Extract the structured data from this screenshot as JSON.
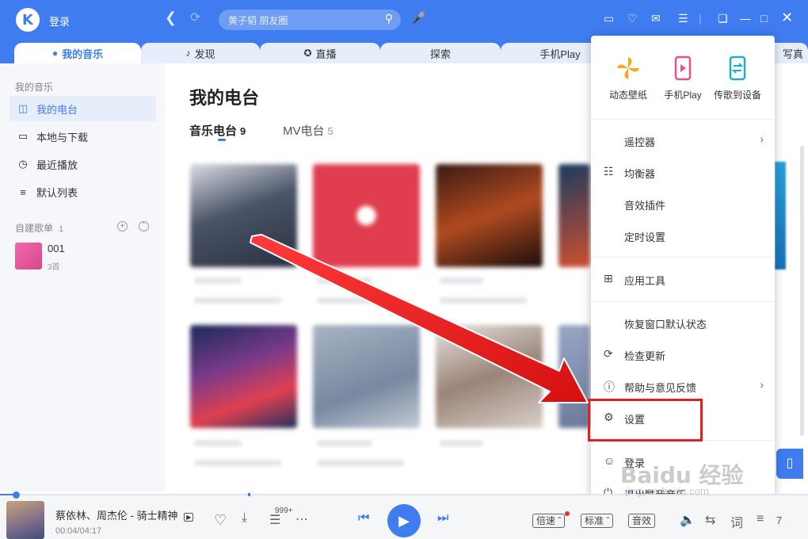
{
  "header": {
    "logo_letter": "K",
    "login": "登录",
    "search_placeholder": "黄子韬 朋友圈"
  },
  "tabs": [
    {
      "label": "我的音乐",
      "icon": "person-icon"
    },
    {
      "label": "发现",
      "icon": "music-note-icon"
    },
    {
      "label": "直播",
      "icon": "star-icon"
    },
    {
      "label": "探索",
      "icon": ""
    },
    {
      "label": "手机Play",
      "icon": ""
    },
    {
      "label": "写真",
      "icon": ""
    }
  ],
  "sidebar": {
    "section_title": "我的音乐",
    "items": [
      {
        "label": "我的电台",
        "icon": "radio-icon"
      },
      {
        "label": "本地与下载",
        "icon": "monitor-icon"
      },
      {
        "label": "最近播放",
        "icon": "clock-icon"
      },
      {
        "label": "默认列表",
        "icon": "list-icon"
      }
    ],
    "playlists_title": "自建歌单",
    "playlists_count": "1",
    "playlist": {
      "name": "001",
      "count": "3首"
    }
  },
  "main": {
    "title": "我的电台",
    "subtabs": [
      {
        "label": "音乐电台",
        "count": "9"
      },
      {
        "label": "MV电台",
        "count": "5"
      }
    ]
  },
  "menu": {
    "top_items": [
      {
        "label": "动态壁纸",
        "icon": "pinwheel-icon"
      },
      {
        "label": "手机Play",
        "icon": "phone-play-icon"
      },
      {
        "label": "传歌到设备",
        "icon": "transfer-icon"
      }
    ],
    "items": [
      {
        "label": "遥控器",
        "icon": "",
        "chevron": true
      },
      {
        "label": "均衡器",
        "icon": "equalizer-icon",
        "chevron": false
      },
      {
        "label": "音效插件",
        "icon": "",
        "chevron": false
      },
      {
        "label": "定时设置",
        "icon": "",
        "chevron": false
      },
      {
        "label": "应用工具",
        "icon": "grid-icon",
        "chevron": false
      },
      {
        "label": "恢复窗口默认状态",
        "icon": "",
        "chevron": false
      },
      {
        "label": "检查更新",
        "icon": "refresh-icon",
        "chevron": false
      },
      {
        "label": "帮助与意见反馈",
        "icon": "help-icon",
        "chevron": true
      },
      {
        "label": "设置",
        "icon": "gear-icon",
        "chevron": false
      },
      {
        "label": "登录",
        "icon": "user-icon",
        "chevron": false
      },
      {
        "label": "退出酷我音乐",
        "icon": "power-icon",
        "chevron": false
      }
    ]
  },
  "player": {
    "song": "蔡依林、周杰伦 - 骑士精神",
    "time": "00:04/04:17",
    "comment_count": "999+",
    "speed": "倍速",
    "quality": "标准",
    "effect": "音效",
    "playlist_count": "7",
    "progress": 0.016
  },
  "watermark": {
    "brand": "Baidu 经验",
    "url": "jingyan.baidu.com"
  },
  "colors": {
    "accent": "#3f7cf0",
    "highlight_box": "#e02020",
    "arrow": "#e01818"
  }
}
